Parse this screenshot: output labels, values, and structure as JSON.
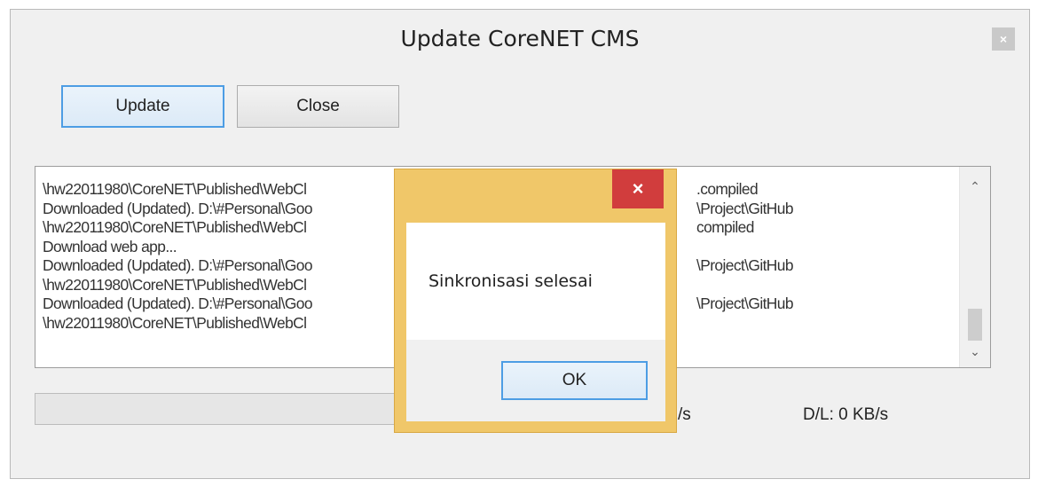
{
  "window": {
    "title": "Update CoreNET CMS",
    "close_glyph": "×"
  },
  "toolbar": {
    "update_label": "Update",
    "close_label": "Close"
  },
  "log": {
    "lines": [
      {
        "left": "\\hw22011980\\CoreNET\\Published\\WebCl",
        "right": ".compiled"
      },
      {
        "left": "Downloaded (Updated). D:\\#Personal\\Goo",
        "right": "\\Project\\GitHub"
      },
      {
        "left": "\\hw22011980\\CoreNET\\Published\\WebCl",
        "right": "compiled"
      },
      {
        "left": "Download web app...",
        "right": ""
      },
      {
        "left": "Downloaded (Updated). D:\\#Personal\\Goo",
        "right": "\\Project\\GitHub"
      },
      {
        "left": "\\hw22011980\\CoreNET\\Published\\WebCl",
        "right": ""
      },
      {
        "left": "Downloaded (Updated). D:\\#Personal\\Goo",
        "right": "\\Project\\GitHub"
      },
      {
        "left": "\\hw22011980\\CoreNET\\Published\\WebCl",
        "right": ""
      }
    ],
    "scroll_up_icon": "chevron-up-icon",
    "scroll_down_icon": "chevron-down-icon"
  },
  "status": {
    "speed_fragment": "/s",
    "download_rate": "D/L:  0 KB/s"
  },
  "dialog": {
    "close_glyph": "×",
    "message": "Sinkronisasi selesai",
    "ok_label": "OK"
  },
  "colors": {
    "dialog_frame": "#f0c769",
    "dialog_close": "#d13d3d",
    "focus_border": "#4d9de4"
  }
}
